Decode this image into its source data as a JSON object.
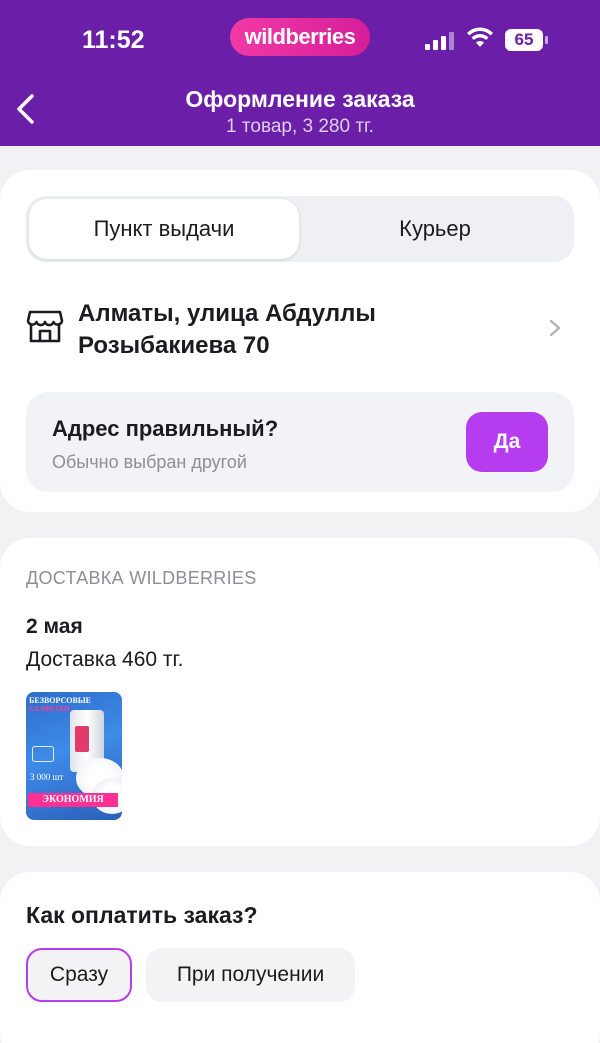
{
  "status_bar": {
    "time": "11:52",
    "brand": "wildberries",
    "battery": "65"
  },
  "header": {
    "title": "Оформление заказа",
    "subtitle": "1 товар, 3 280 тг."
  },
  "delivery": {
    "tabs": [
      "Пункт выдачи",
      "Курьер"
    ],
    "selected_tab": "Пункт выдачи",
    "address_line1": "Алматы, улица Абдуллы",
    "address_line2": "Розыбакиева 70",
    "confirm_title": "Адрес правильный?",
    "confirm_hint": "Обычно выбран другой",
    "confirm_button": "Да"
  },
  "shipment": {
    "caption": "ДОСТАВКА WILDBERRIES",
    "date": "2 мая",
    "cost": "Доставка 460 тг.",
    "product_image_text": {
      "line1": "БЕЗВОРСОВЫЕ",
      "line2": "САЛФЕТКИ",
      "qty": "3 000 шт",
      "badge": "ЭКОНОМИЯ"
    }
  },
  "payment": {
    "title": "Как оплатить заказ?",
    "options": [
      "Сразу",
      "При получении"
    ],
    "selected": "Сразу"
  },
  "colors": {
    "header": "#6b1fa8",
    "accent": "#b63cf0",
    "brand_pill": "#e22a9f"
  }
}
